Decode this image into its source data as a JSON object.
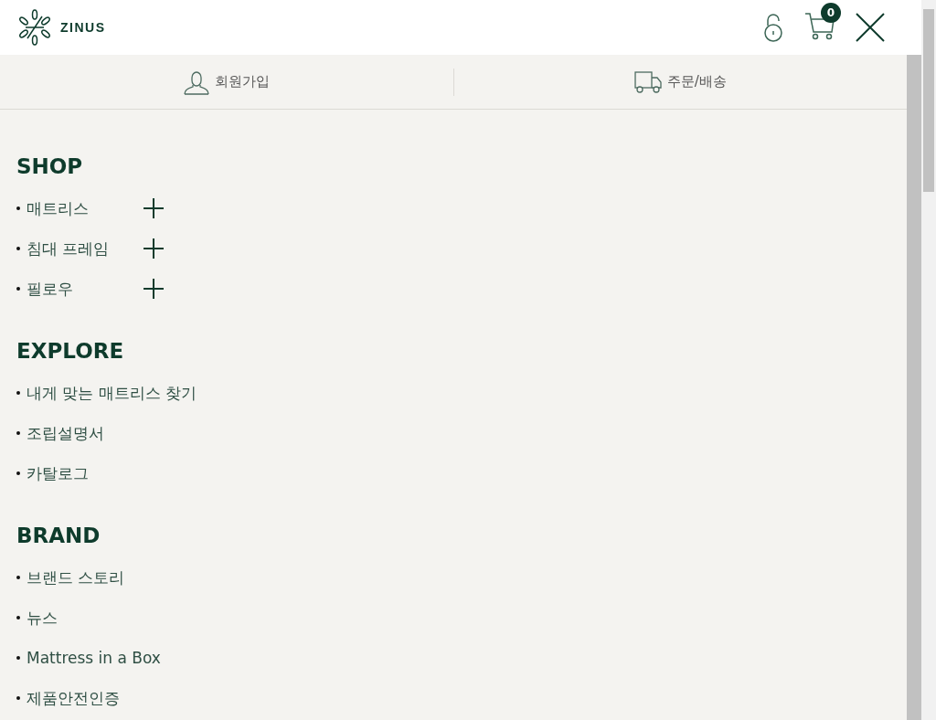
{
  "header": {
    "logo": "ZINUS",
    "cart_count": "0"
  },
  "nav": [
    {
      "label": "회원가입",
      "kind": "user"
    },
    {
      "label": "주문/배송",
      "kind": "truck"
    }
  ],
  "sections": [
    {
      "title": "SHOP",
      "items": [
        {
          "label": "매트리스",
          "expandable": true
        },
        {
          "label": "침대 프레임",
          "expandable": true
        },
        {
          "label": "필로우",
          "expandable": true
        }
      ]
    },
    {
      "title": "EXPLORE",
      "items": [
        {
          "label": "내게 맞는 매트리스 찾기",
          "expandable": false
        },
        {
          "label": "조립설명서",
          "expandable": false
        },
        {
          "label": "카탈로그",
          "expandable": false
        }
      ]
    },
    {
      "title": "BRAND",
      "items": [
        {
          "label": "브랜드 스토리",
          "expandable": false
        },
        {
          "label": "뉴스",
          "expandable": false
        },
        {
          "label": "Mattress in a Box",
          "expandable": false
        },
        {
          "label": "제품안전인증",
          "expandable": false
        }
      ]
    }
  ]
}
